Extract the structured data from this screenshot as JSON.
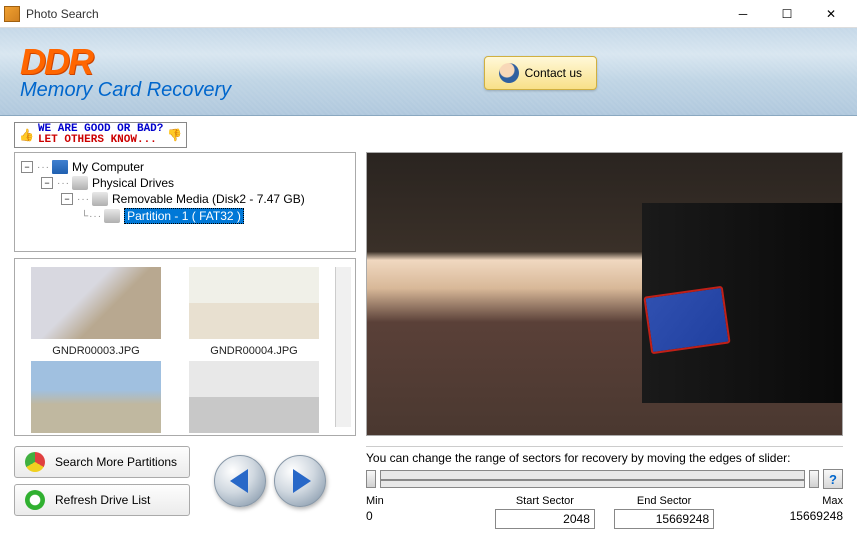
{
  "window": {
    "title": "Photo Search"
  },
  "header": {
    "logo_main": "DDR",
    "logo_sub": "Memory Card Recovery",
    "contact_label": "Contact us"
  },
  "rating": {
    "line1": "WE ARE GOOD OR BAD?",
    "line2": "LET OTHERS KNOW..."
  },
  "tree": {
    "root": "My Computer",
    "physical": "Physical Drives",
    "removable": "Removable Media (Disk2 - 7.47 GB)",
    "partition": "Partition - 1 ( FAT32 )"
  },
  "thumbs": [
    {
      "name": "GNDR00003.JPG"
    },
    {
      "name": "GNDR00004.JPG"
    },
    {
      "name": ""
    },
    {
      "name": ""
    }
  ],
  "buttons": {
    "search_more": "Search More Partitions",
    "refresh": "Refresh Drive List"
  },
  "sectors": {
    "instruction": "You can change the range of sectors for recovery by moving the edges of slider:",
    "min_label": "Min",
    "min_value": "0",
    "start_label": "Start Sector",
    "start_value": "2048",
    "end_label": "End Sector",
    "end_value": "15669248",
    "max_label": "Max",
    "max_value": "15669248",
    "help": "?"
  }
}
